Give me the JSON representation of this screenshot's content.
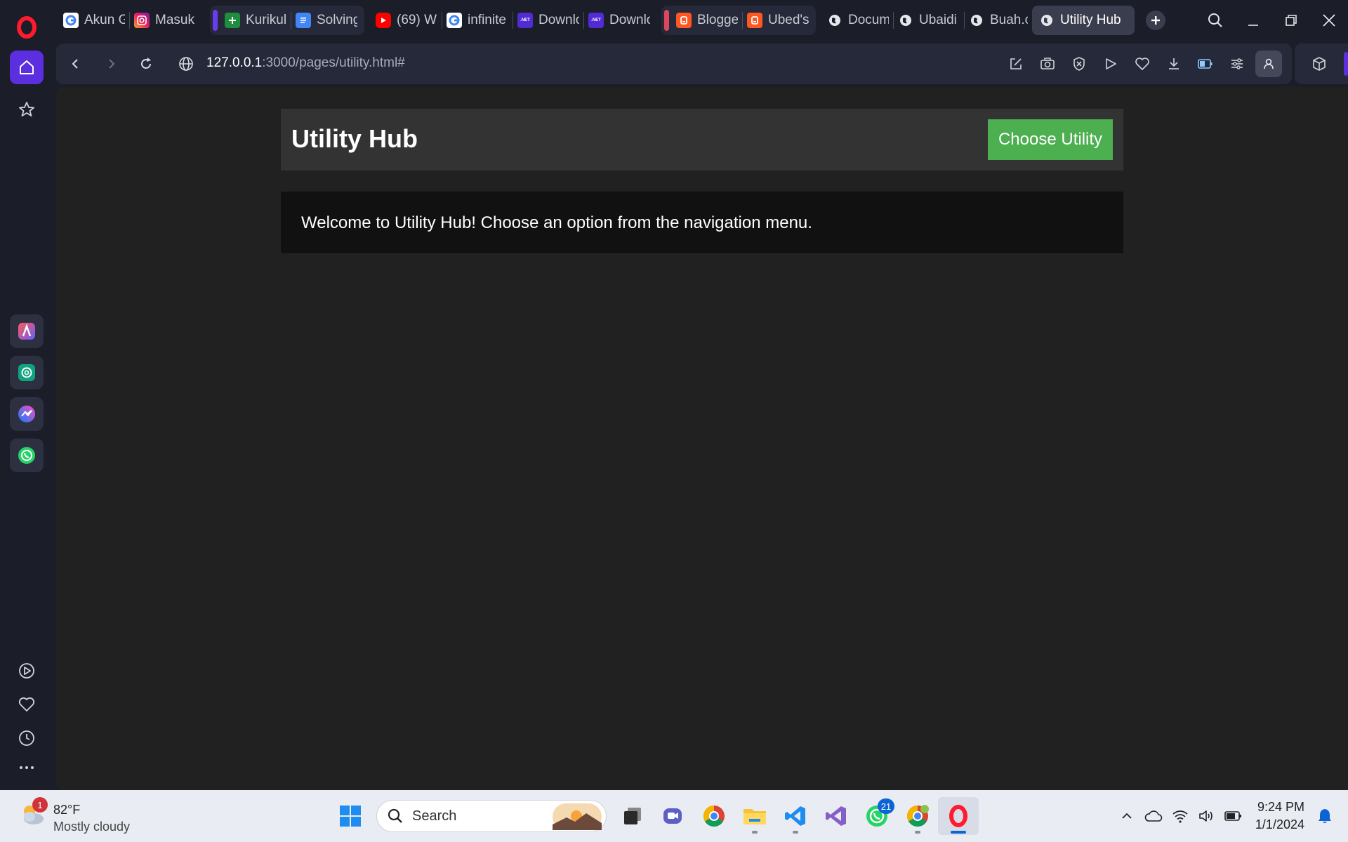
{
  "browser": {
    "tabs_group1": [
      {
        "label": "Akun G",
        "icon": "google-icon"
      },
      {
        "label": "Masuk",
        "icon": "instagram-icon"
      }
    ],
    "tabs_group2": [
      {
        "label": "Kurikul",
        "icon": "sheets-icon"
      },
      {
        "label": "Solving",
        "icon": "docs-icon"
      }
    ],
    "tabs_group3": [
      {
        "label": "(69) W",
        "icon": "youtube-icon"
      },
      {
        "label": "infinite",
        "icon": "google-icon"
      },
      {
        "label": "Downlo",
        "icon": "dotnet-icon"
      },
      {
        "label": "Downlo",
        "icon": "dotnet-icon"
      }
    ],
    "tabs_group4": [
      {
        "label": "Blogge",
        "icon": "blogger-icon"
      },
      {
        "label": "Ubed's",
        "icon": "blogger-icon"
      }
    ],
    "tabs_group5": [
      {
        "label": "Docum",
        "icon": "globe-icon"
      },
      {
        "label": "Ubaidi",
        "icon": "globe-icon"
      },
      {
        "label": "Buah.c",
        "icon": "globe-icon"
      }
    ],
    "active_tab": {
      "label": "Utility Hub",
      "icon": "globe-icon"
    },
    "dotnet_favicon_text": ".NET",
    "group_colors": {
      "group2": "#6a3cf0",
      "group4": "#e0455a"
    },
    "url_host": "127.0.0.1",
    "url_rest": ":3000/pages/utility.html#"
  },
  "page": {
    "title": "Utility Hub",
    "choose_button": "Choose Utility",
    "welcome": "Welcome to Utility Hub! Choose an option from the navigation menu.",
    "accent_color": "#4caf50"
  },
  "taskbar": {
    "weather_badge": "1",
    "temperature": "82°F",
    "condition": "Mostly cloudy",
    "search_label": "Search",
    "whatsapp_badge": "21",
    "time": "9:24 PM",
    "date": "1/1/2024"
  }
}
